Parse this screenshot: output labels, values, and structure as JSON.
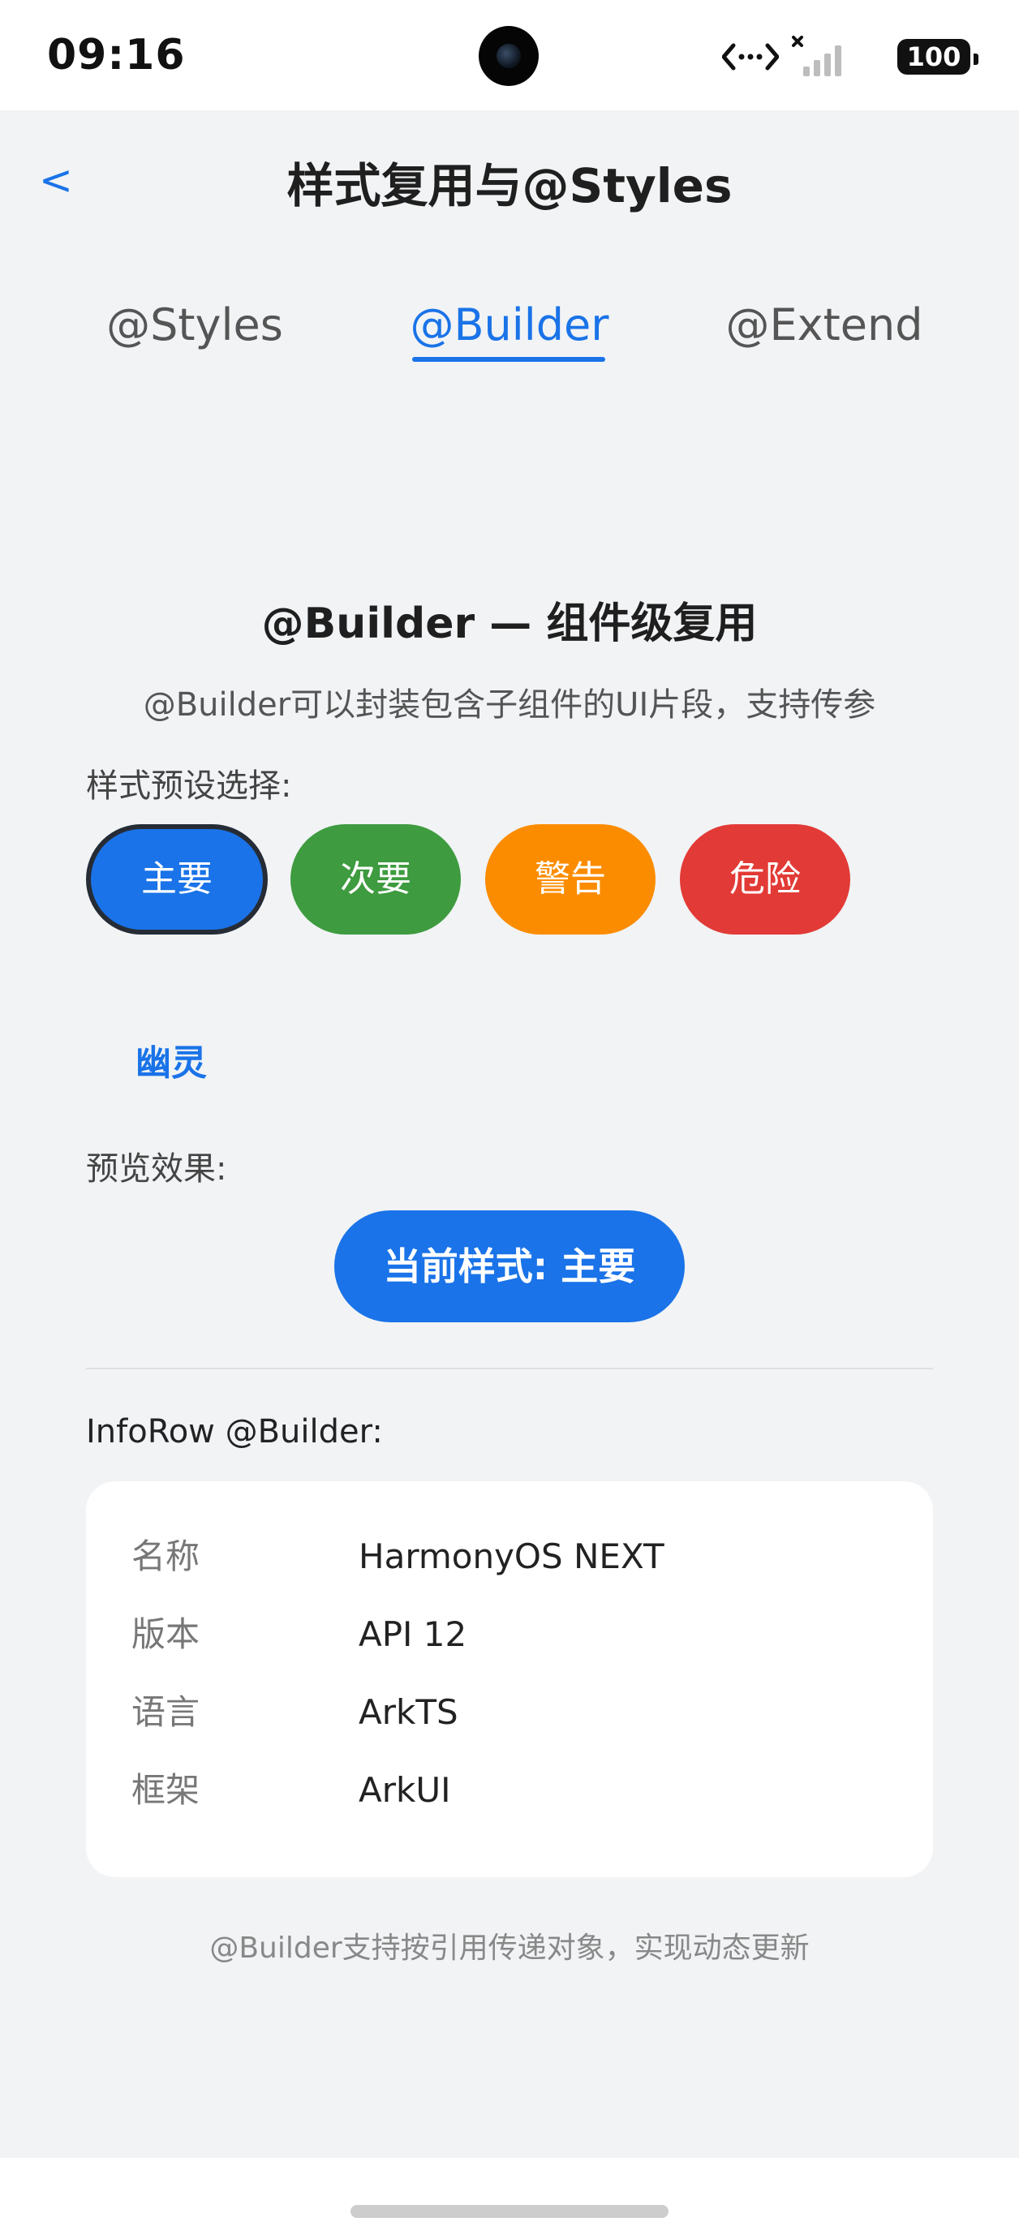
{
  "status_bar": {
    "time": "09:16",
    "battery": "100",
    "link_icon": "link-icon",
    "signal_icon": "signal-icon"
  },
  "nav": {
    "back_label": "<",
    "title": "样式复用与@Styles"
  },
  "tabs": [
    {
      "label": "@Styles",
      "active": false
    },
    {
      "label": "@Builder",
      "active": true
    },
    {
      "label": "@Extend",
      "active": false
    }
  ],
  "section": {
    "heading": "@Builder — 组件级复用",
    "description": "@Builder可以封装包含子组件的UI片段，支持传参"
  },
  "presets": {
    "label": "样式预设选择:",
    "items": [
      {
        "label": "主要",
        "color": "#1a73e8",
        "selected": true
      },
      {
        "label": "次要",
        "color": "#3e9b3f",
        "selected": false
      },
      {
        "label": "警告",
        "color": "#fb8c00",
        "selected": false
      },
      {
        "label": "危险",
        "color": "#e23a36",
        "selected": false
      },
      {
        "label": "幽灵",
        "color": "transparent",
        "selected": false
      }
    ]
  },
  "preview": {
    "label": "预览效果:",
    "button_text": "当前样式: 主要"
  },
  "info_row": {
    "label": "InfoRow @Builder:",
    "rows": [
      {
        "key": "名称",
        "value": "HarmonyOS NEXT"
      },
      {
        "key": "版本",
        "value": "API 12"
      },
      {
        "key": "语言",
        "value": "ArkTS"
      },
      {
        "key": "框架",
        "value": "ArkUI"
      }
    ]
  },
  "footnote": "@Builder支持按引用传递对象，实现动态更新"
}
